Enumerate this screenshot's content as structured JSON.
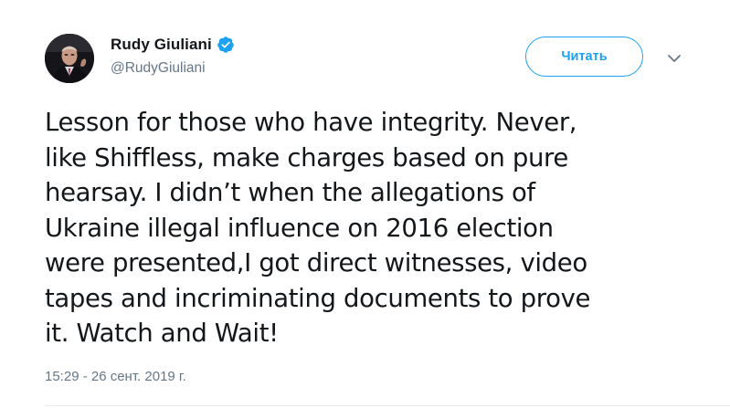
{
  "author": {
    "name": "Rudy Giuliani",
    "handle": "@RudyGiuliani",
    "verified": true,
    "avatar_icon": "profile-photo"
  },
  "actions": {
    "follow_label": "Читать",
    "menu_icon": "chevron-down-icon"
  },
  "tweet": {
    "text": "Lesson for those who have integrity. Never, \nlike Shiffless,  make charges based on pure \nhearsay. I didn’t when the allegations of \nUkraine illegal influence on 2016 election \nwere presented,I got direct witnesses, video \ntapes and incriminating documents to prove \nit. Watch and Wait!",
    "timestamp": "15:29 - 26 сент. 2019 г."
  },
  "colors": {
    "accent": "#1da1f2",
    "text": "#14171a",
    "muted": "#657786",
    "divider": "#e6ecf0"
  }
}
